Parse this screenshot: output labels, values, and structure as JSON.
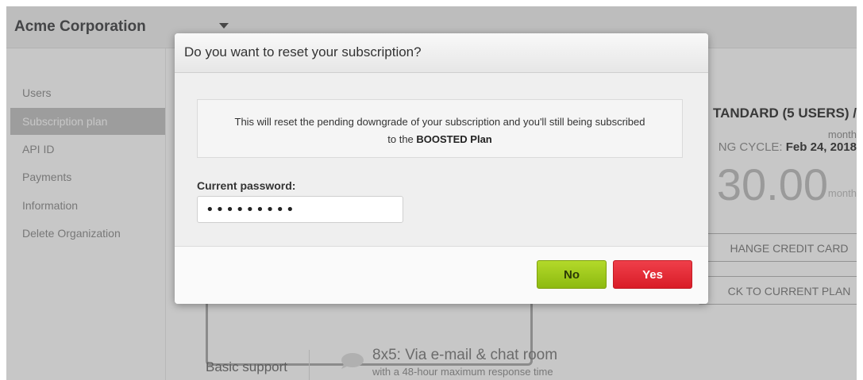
{
  "app": {
    "organization": "Acme Corporation"
  },
  "sidebar": {
    "items": [
      {
        "label": "Users",
        "active": false
      },
      {
        "label": "Subscription plan",
        "active": true
      },
      {
        "label": "API ID",
        "active": false
      },
      {
        "label": "Payments",
        "active": false
      },
      {
        "label": "Information",
        "active": false
      },
      {
        "label": "Delete Organization",
        "active": false
      }
    ]
  },
  "plan": {
    "name": "TANDARD (5 USERS) /",
    "per": "month",
    "billing_label": "NG CYCLE: ",
    "billing_date": "Feb 24, 2018",
    "price": "30.00",
    "price_unit": "/ month",
    "change_card_label": "HANGE CREDIT CARD",
    "back_label": "CK TO CURRENT PLAN"
  },
  "support": {
    "label": "Basic support",
    "main": "8x5: Via e-mail & chat room",
    "sub": "with a 48-hour maximum response time"
  },
  "dialog": {
    "title": "Do you want to reset your subscription?",
    "message_line1": "This will reset the pending downgrade of your subscription and you'll still being subscribed",
    "message_line2_prefix": "to the ",
    "message_line2_bold": "BOOSTED Plan",
    "password_label": "Current password:",
    "password_value": "•••••••••",
    "no_label": "No",
    "yes_label": "Yes"
  },
  "icons": {
    "org_menu": "chevron-down-icon",
    "support": "chat-bubble-icon"
  },
  "colors": {
    "no_button": "#9cc61b",
    "yes_button": "#e22a34",
    "active_sidebar": "#c9c9c9"
  }
}
